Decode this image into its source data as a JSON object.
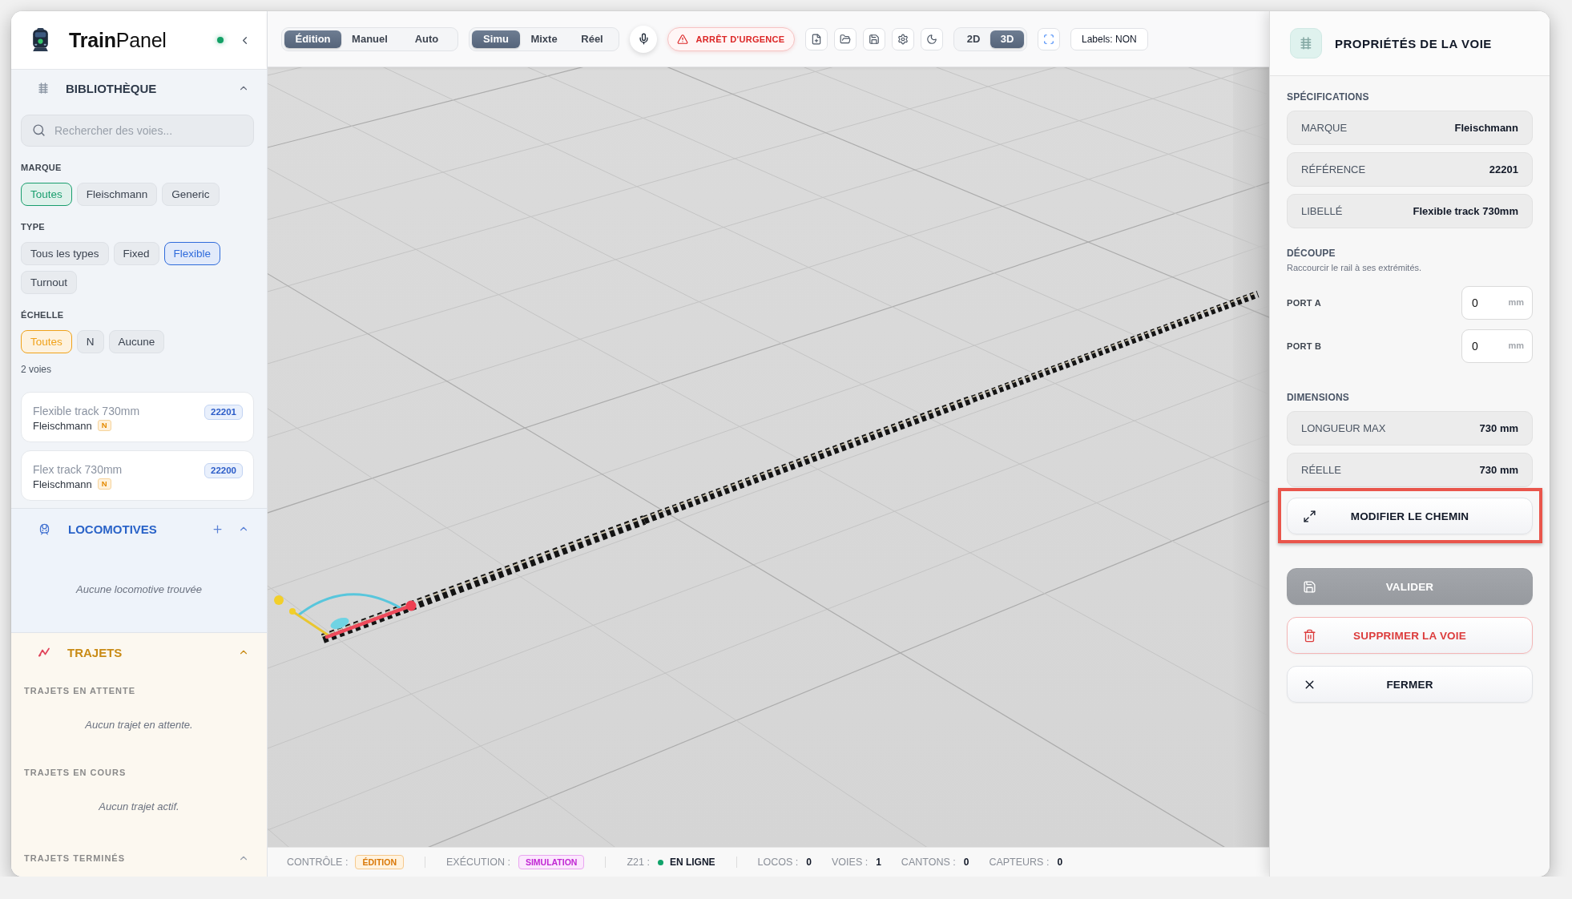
{
  "sidebar": {
    "brand": {
      "name": "**Train**Panel",
      "online": true
    },
    "library": {
      "title": "BIBLIOTHÈQUE",
      "expanded": true,
      "search": {
        "placeholder": "Rechercher des voies..."
      },
      "filters": [
        {
          "title": "MARQUE",
          "color": "#1a9e6e",
          "options": [
            {
              "label": "Toutes",
              "selected": true
            },
            {
              "label": "Fleischmann",
              "selected": false
            },
            {
              "label": "Generic",
              "selected": false
            }
          ]
        },
        {
          "title": "TYPE",
          "color": "#2f6bdb",
          "options": [
            {
              "label": "Tous les types",
              "selected": false
            },
            {
              "label": "Fixed",
              "selected": false
            },
            {
              "label": "Flexible",
              "selected": true
            },
            {
              "label": "Turnout",
              "selected": false
            }
          ]
        },
        {
          "title": "ÉCHELLE",
          "color": "#f0a21a",
          "options": [
            {
              "label": "Toutes",
              "selected": true
            },
            {
              "label": "N",
              "selected": false
            },
            {
              "label": "Aucune",
              "selected": false
            }
          ]
        }
      ],
      "count": "2 voies",
      "tracks": [
        {
          "name": "Flexible track 730mm",
          "brand": "Fleischmann",
          "scale": "N",
          "reference": "22201"
        },
        {
          "name": "Flex track 730mm",
          "brand": "Fleischmann",
          "scale": "N",
          "reference": "22200"
        }
      ]
    },
    "locomotives": {
      "title": "LOCOMOTIVES",
      "expanded": true,
      "empty_text": "Aucune locomotive trouvée"
    },
    "routes": {
      "title": "TRAJETS",
      "expanded": true,
      "pending": {
        "title": "TRAJETS EN ATTENTE",
        "empty_text": "Aucun trajet en attente."
      },
      "active": {
        "title": "TRAJETS EN COURS",
        "empty_text": "Aucun trajet actif."
      },
      "finished": {
        "title": "TRAJETS TERMINÉS",
        "expanded": true
      }
    }
  },
  "toolbar": {
    "mode_tabs": [
      {
        "label": "Édition",
        "selected": true
      },
      {
        "label": "Manuel",
        "selected": false
      },
      {
        "label": "Auto",
        "selected": false
      }
    ],
    "execution_tabs": [
      {
        "label": "Simu",
        "selected": true
      },
      {
        "label": "Mixte",
        "selected": false
      },
      {
        "label": "Réel",
        "selected": false
      }
    ],
    "emergency_button": {
      "label": "ARRÊT D'URGENCE"
    },
    "view_tabs": [
      {
        "label": "2D",
        "selected": false
      },
      {
        "label": "3D",
        "selected": true
      }
    ],
    "labels_toggle": {
      "label": "Labels: NON"
    }
  },
  "properties_panel": {
    "title": "PROPRIÉTÉS DE LA VOIE",
    "specifications": {
      "title": "SPÉCIFICATIONS",
      "rows": [
        {
          "label": "MARQUE",
          "value": "Fleischmann"
        },
        {
          "label": "RÉFÉRENCE",
          "value": "22201"
        },
        {
          "label": "LIBELLÉ",
          "value": "Flexible track 730mm"
        }
      ]
    },
    "cut": {
      "title": "DÉCOUPE",
      "description": "Raccourcir le rail à ses extrémités.",
      "ports": [
        {
          "label": "PORT A",
          "value": "0",
          "unit": "mm"
        },
        {
          "label": "PORT B",
          "value": "0",
          "unit": "mm"
        }
      ]
    },
    "dimensions": {
      "title": "DIMENSIONS",
      "rows": [
        {
          "label": "LONGUEUR MAX",
          "value": "730 mm"
        },
        {
          "label": "RÉELLE",
          "value": "730 mm"
        }
      ]
    },
    "actions": [
      {
        "kind": "edit-path",
        "label": "MODIFIER LE CHEMIN",
        "highlighted": true,
        "disabled": false
      },
      {
        "kind": "save",
        "label": "VALIDER",
        "highlighted": false,
        "disabled": true
      },
      {
        "kind": "delete",
        "label": "SUPPRIMER LA VOIE",
        "highlighted": false,
        "disabled": false
      },
      {
        "kind": "close",
        "label": "FERMER",
        "highlighted": false,
        "disabled": false
      }
    ]
  },
  "status_bar": {
    "control": {
      "label": "CONTRÔLE :",
      "value": "ÉDITION"
    },
    "execution": {
      "label": "EXÉCUTION :",
      "value": "SIMULATION"
    },
    "z21": {
      "label": "Z21 :",
      "value": "EN LIGNE",
      "online": true
    },
    "counters": [
      {
        "label": "LOCOS :",
        "value": "0"
      },
      {
        "label": "VOIES :",
        "value": "1"
      },
      {
        "label": "CANTONS :",
        "value": "0"
      },
      {
        "label": "CAPTEURS :",
        "value": "0"
      }
    ]
  }
}
